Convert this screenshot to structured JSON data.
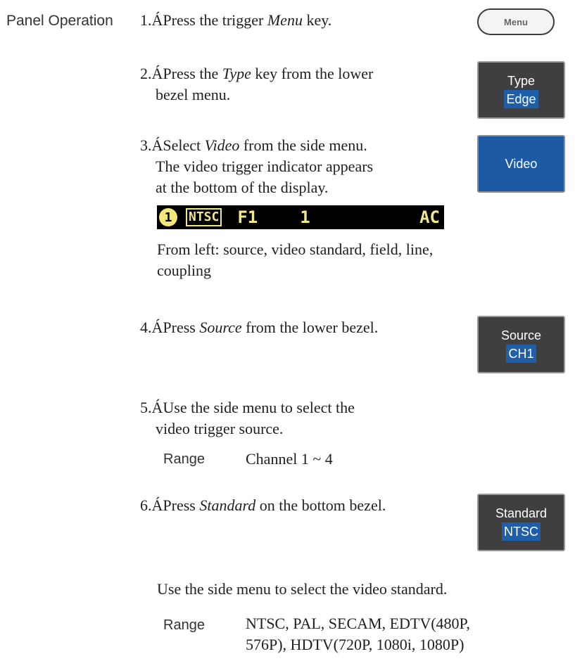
{
  "section_label": "Panel Operation",
  "steps": [
    {
      "num": "1.Á",
      "pre": "Press the trigger ",
      "em": "Menu",
      "post": " key."
    },
    {
      "num": "2.Á",
      "pre": "Press the ",
      "em": "Type",
      "post": " key from the lower",
      "line2": "bezel menu."
    },
    {
      "num": "3.Á",
      "pre": "Select ",
      "em": "Video",
      "post": " from the side menu.",
      "line2": "The video trigger indicator appears",
      "line3": "at the bottom of the display."
    },
    {
      "num": "4.Á",
      "pre": "Press ",
      "em": "Source",
      "post": " from the lower bezel."
    },
    {
      "num": "5.Á",
      "text": "Use the side menu to select the",
      "line2": "video trigger source."
    },
    {
      "num": "6.Á",
      "pre": "Press ",
      "em": "Standard",
      "post": " on the bottom bezel."
    }
  ],
  "indicator": {
    "source": "1",
    "standard": "NTSC",
    "field": "F1",
    "line": "1",
    "coupling": "AC"
  },
  "indicator_caption": {
    "line1": "From left: source, video standard, field, line,",
    "line2": "coupling"
  },
  "range_source": {
    "label": "Range",
    "value": "Channel 1 ~ 4"
  },
  "standard_note": "Use the side menu to select the video standard.",
  "range_standard": {
    "label": "Range",
    "value_line1": "NTSC, PAL, SECAM, EDTV(480P,",
    "value_line2": "576P), HDTV(720P, 1080i, 1080P)"
  },
  "buttons": {
    "menu": "Menu",
    "type": {
      "top": "Type",
      "bottom": "Edge"
    },
    "video": "Video",
    "source": {
      "top": "Source",
      "bottom": "CH1"
    },
    "standard": {
      "top": "Standard",
      "bottom": "NTSC"
    }
  },
  "colors": {
    "softkey_bg": "#3f3f3f",
    "highlight_blue": "#1f5ea8",
    "indicator_yellow": "#f0e68c"
  }
}
